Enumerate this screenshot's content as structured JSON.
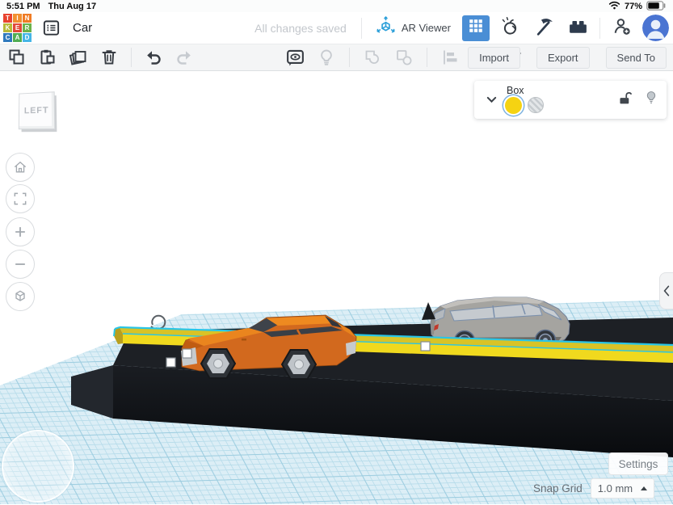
{
  "status_bar": {
    "time": "5:51 PM",
    "date": "Thu Aug 17",
    "battery_percent": "77%"
  },
  "header": {
    "logo_tiles": [
      {
        "char": "T",
        "color": "#e8432f"
      },
      {
        "char": "I",
        "color": "#f29030"
      },
      {
        "char": "N",
        "color": "#ef7b24"
      },
      {
        "char": "K",
        "color": "#b8ba39"
      },
      {
        "char": "E",
        "color": "#e2483a"
      },
      {
        "char": "R",
        "color": "#6cb24a"
      },
      {
        "char": "C",
        "color": "#2f79bd"
      },
      {
        "char": "A",
        "color": "#51ad53"
      },
      {
        "char": "D",
        "color": "#45b5e6"
      }
    ],
    "design_title": "Car",
    "save_status": "All changes saved",
    "ar_viewer_label": "AR Viewer"
  },
  "toolbar": {
    "import_label": "Import",
    "export_label": "Export",
    "send_to_label": "Send To"
  },
  "inspector": {
    "shape_name": "Box"
  },
  "view_cube": {
    "face_label": "LEFT"
  },
  "footer": {
    "settings_label": "Settings",
    "snap_grid_label": "Snap Grid",
    "snap_grid_value": "1.0 mm"
  },
  "colors": {
    "accent_blue": "#4a8ed5",
    "ar_icon_blue": "#2b9fd9",
    "selection_cyan": "#29c5e6",
    "workplane": "#dceef6",
    "workplane_line": "#b7dcea",
    "road_black": "#1d2025",
    "stripe_yellow": "#f0d91e",
    "car_orange": "#d2691e",
    "van_gray": "#a5a4a0",
    "swatch_yellow": "#f5d312"
  }
}
